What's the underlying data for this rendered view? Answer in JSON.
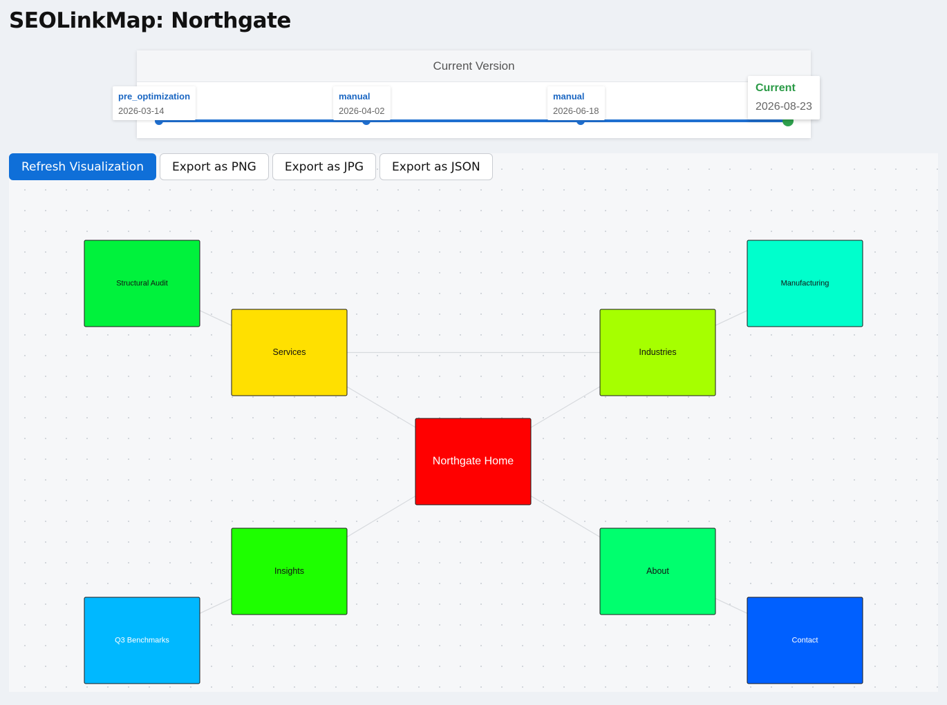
{
  "app": {
    "title": "SEOLinkMap: Northgate"
  },
  "timeline": {
    "header": "Current Version",
    "versions": [
      {
        "label": "pre_optimization",
        "date": "2026-03-14"
      },
      {
        "label": "manual",
        "date": "2026-04-02"
      },
      {
        "label": "manual",
        "date": "2026-06-18"
      },
      {
        "label": "Current",
        "date": "2026-08-23"
      }
    ],
    "track_color": "#1f6fd0",
    "current_color": "#2fa24e"
  },
  "toolbar": {
    "refresh_label": "Refresh Visualization",
    "export_png_label": "Export as PNG",
    "export_jpg_label": "Export as JPG",
    "export_json_label": "Export as JSON"
  },
  "graph": {
    "nodes": [
      {
        "id": "home",
        "label": "Northgate Home",
        "color": "#ff0000",
        "text_color": "#ffffff"
      },
      {
        "id": "services",
        "label": "Services",
        "color": "#ffe000",
        "text_color": "#111111"
      },
      {
        "id": "industries",
        "label": "Industries",
        "color": "#a6ff00",
        "text_color": "#111111"
      },
      {
        "id": "insights",
        "label": "Insights",
        "color": "#1eff00",
        "text_color": "#111111"
      },
      {
        "id": "about",
        "label": "About",
        "color": "#00ff6e",
        "text_color": "#111111"
      },
      {
        "id": "structural-audit",
        "label": "Structural Audit",
        "color": "#00f23c",
        "text_color": "#111111"
      },
      {
        "id": "manufacturing",
        "label": "Manufacturing",
        "color": "#00ffcc",
        "text_color": "#111111"
      },
      {
        "id": "q3-benchmarks",
        "label": "Q3 Benchmarks",
        "color": "#00b8ff",
        "text_color": "#ffffff"
      },
      {
        "id": "contact",
        "label": "Contact",
        "color": "#0060ff",
        "text_color": "#ffffff"
      }
    ],
    "edges": [
      [
        "home",
        "services"
      ],
      [
        "home",
        "industries"
      ],
      [
        "home",
        "insights"
      ],
      [
        "home",
        "about"
      ],
      [
        "services",
        "industries"
      ],
      [
        "services",
        "structural-audit"
      ],
      [
        "industries",
        "manufacturing"
      ],
      [
        "insights",
        "q3-benchmarks"
      ],
      [
        "about",
        "contact"
      ]
    ]
  }
}
